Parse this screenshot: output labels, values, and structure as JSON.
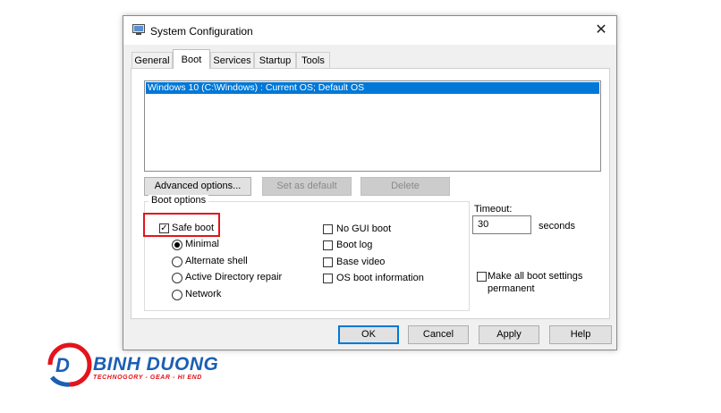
{
  "window": {
    "title": "System Configuration"
  },
  "tabs": [
    {
      "label": "General"
    },
    {
      "label": "Boot"
    },
    {
      "label": "Services"
    },
    {
      "label": "Startup"
    },
    {
      "label": "Tools"
    }
  ],
  "active_tab": "Boot",
  "os_list": {
    "items": [
      "Windows 10 (C:\\Windows) : Current OS; Default OS"
    ]
  },
  "action_buttons": {
    "advanced": "Advanced options...",
    "set_default": "Set as default",
    "delete": "Delete"
  },
  "boot_options": {
    "group_label": "Boot options",
    "safe_boot": {
      "label": "Safe boot",
      "checked": true
    },
    "safe_modes": [
      {
        "label": "Minimal",
        "selected": true
      },
      {
        "label": "Alternate shell",
        "selected": false
      },
      {
        "label": "Active Directory repair",
        "selected": false
      },
      {
        "label": "Network",
        "selected": false
      }
    ],
    "options": [
      {
        "label": "No GUI boot",
        "checked": false
      },
      {
        "label": "Boot log",
        "checked": false
      },
      {
        "label": "Base video",
        "checked": false
      },
      {
        "label": "OS boot information",
        "checked": false
      }
    ]
  },
  "timeout": {
    "label": "Timeout:",
    "value": "30",
    "unit": "seconds"
  },
  "make_permanent": {
    "label_line1": "Make all boot settings",
    "label_line2": "permanent",
    "checked": false
  },
  "footer_buttons": {
    "ok": "OK",
    "cancel": "Cancel",
    "apply": "Apply",
    "help": "Help"
  },
  "logo": {
    "name": "BINH DUONG",
    "tagline": "TECHNOGORY - GEAR - HI END"
  },
  "colors": {
    "accent": "#0078d7",
    "highlight_red": "#e3141c",
    "logo_blue": "#1b5fb3",
    "logo_red": "#e3141c"
  }
}
